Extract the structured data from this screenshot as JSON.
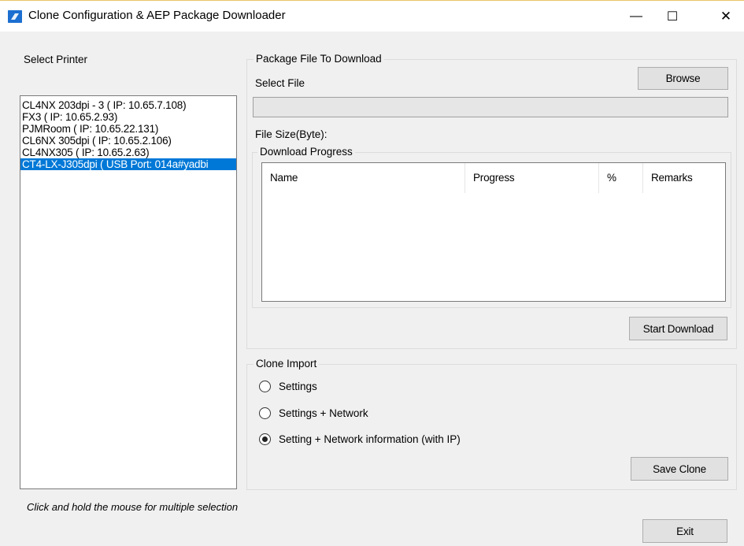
{
  "window": {
    "title": "Clone Configuration & AEP Package Downloader",
    "minimize_glyph": "—",
    "maximize_glyph": "☐",
    "close_glyph": "✕"
  },
  "printer_panel": {
    "label": "Select Printer",
    "items": [
      {
        "label": "CL4NX 203dpi - 3 ( IP: 10.65.7.108)",
        "selected": false
      },
      {
        "label": "FX3 ( IP: 10.65.2.93)",
        "selected": false
      },
      {
        "label": "PJMRoom ( IP: 10.65.22.131)",
        "selected": false
      },
      {
        "label": "CL6NX 305dpi ( IP: 10.65.2.106)",
        "selected": false
      },
      {
        "label": "CL4NX305 ( IP: 10.65.2.63)",
        "selected": false
      },
      {
        "label": "CT4-LX-J305dpi ( USB Port: 014a#yadbi",
        "selected": true
      }
    ],
    "hint": "Click and hold the mouse for multiple selection"
  },
  "package_group": {
    "legend": "Package File To Download",
    "select_file_label": "Select File",
    "browse_label": "Browse",
    "file_path_value": "",
    "file_size_label": "File Size(Byte):",
    "download_progress": {
      "legend": "Download Progress",
      "columns": [
        "Name",
        "Progress",
        "%",
        "Remarks"
      ],
      "rows": []
    },
    "start_download_label": "Start Download"
  },
  "clone_import": {
    "legend": "Clone Import",
    "options": [
      {
        "label": "Settings",
        "checked": false
      },
      {
        "label": "Settings + Network",
        "checked": false
      },
      {
        "label": "Setting + Network information (with IP)",
        "checked": true
      }
    ],
    "save_clone_label": "Save Clone"
  },
  "exit_label": "Exit",
  "colors": {
    "selection": "#0078d7",
    "app_icon": "#1c6fd1",
    "button_face": "#e1e1e1"
  },
  "icons": {
    "app": "app-logo-icon",
    "minimize": "minimize-icon",
    "maximize": "maximize-icon",
    "close": "close-icon"
  }
}
